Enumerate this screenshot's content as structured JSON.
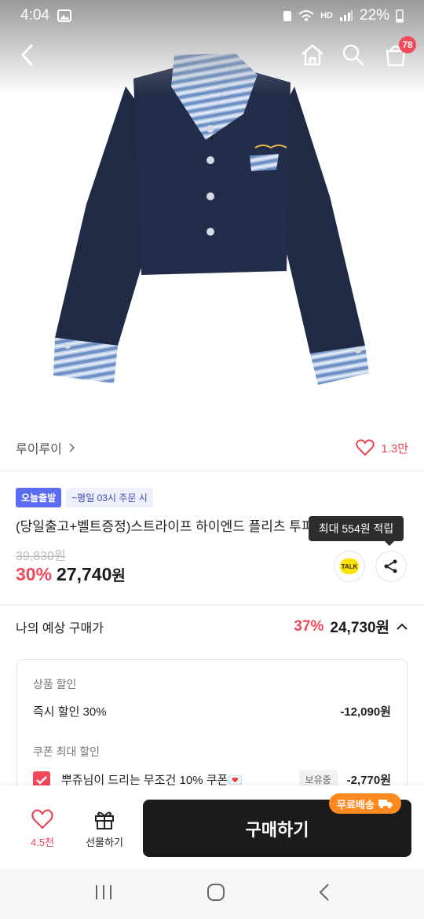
{
  "status_bar": {
    "time": "4:04",
    "battery": "22%"
  },
  "nav": {
    "cart_count": "78"
  },
  "brand": {
    "name": "루이루이",
    "like_count": "1.3만"
  },
  "tags": {
    "delivery": "오늘출발",
    "cutoff": "~평일 03시 주문 시"
  },
  "product": {
    "title": "(당일출고+벨트증정)스트라이프 하이엔드 플리츠 투피스",
    "original_price": "39,830원",
    "discount_pct": "30%",
    "price": "27,740",
    "price_unit": "원"
  },
  "tooltip": {
    "text": "최대 554원 적립"
  },
  "share": {
    "talk_label": "TALK"
  },
  "expected": {
    "label": "나의 예상 구매가",
    "pct": "37%",
    "price": "24,730원"
  },
  "discounts": {
    "product_section": "상품 할인",
    "instant_label": "즉시 할인 30%",
    "instant_amount": "-12,090원",
    "coupon_section": "쿠폰 최대 할인",
    "coupon_label": "뿌쥬님이 드리는 무조건 10% 쿠폰💌",
    "coupon_status": "보유중",
    "coupon_amount": "-2,770원"
  },
  "actions": {
    "wish_count": "4.5천",
    "gift_label": "선물하기",
    "buy_label": "구매하기",
    "free_shipping": "무료배송"
  },
  "colors": {
    "accent": "#f2485a",
    "tag_blue": "#5b6cf2",
    "ship_orange": "#ff8a1f",
    "jacket_navy": "#1f2a44"
  }
}
